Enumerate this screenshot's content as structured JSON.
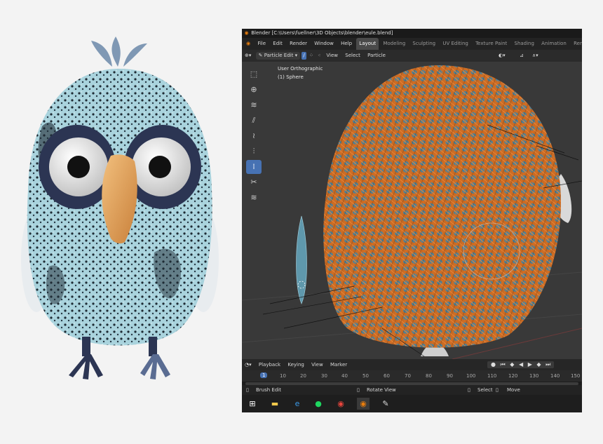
{
  "window": {
    "title": "Blender [C:\\Users\\fuellner\\3D Objects\\blender\\eule.blend]"
  },
  "menu": {
    "items": [
      "File",
      "Edit",
      "Render",
      "Window",
      "Help"
    ]
  },
  "workspaces": {
    "tabs": [
      "Layout",
      "Modeling",
      "Sculpting",
      "UV Editing",
      "Texture Paint",
      "Shading",
      "Animation",
      "Ren"
    ],
    "active": "Layout"
  },
  "toolheader": {
    "mode": "Particle Edit",
    "menus": [
      "View",
      "Select",
      "Particle"
    ]
  },
  "viewport": {
    "view_name": "User Orthographic",
    "object_name": "(1) Sphere"
  },
  "timeline": {
    "menus": [
      "Playback",
      "Keying",
      "View",
      "Marker"
    ],
    "current_frame": "1",
    "ticks": [
      "10",
      "20",
      "30",
      "40",
      "50",
      "60",
      "70",
      "80",
      "90",
      "100",
      "110",
      "120",
      "130",
      "140",
      "150"
    ]
  },
  "status": {
    "left": "Brush Edit",
    "middle": "Rotate View",
    "right1": "Select",
    "right2": "Move"
  },
  "colors": {
    "accent": "#4772b3",
    "hair": "#d86a1e",
    "owl_body": "#a8d2dc",
    "background": "#f3f3f3"
  }
}
